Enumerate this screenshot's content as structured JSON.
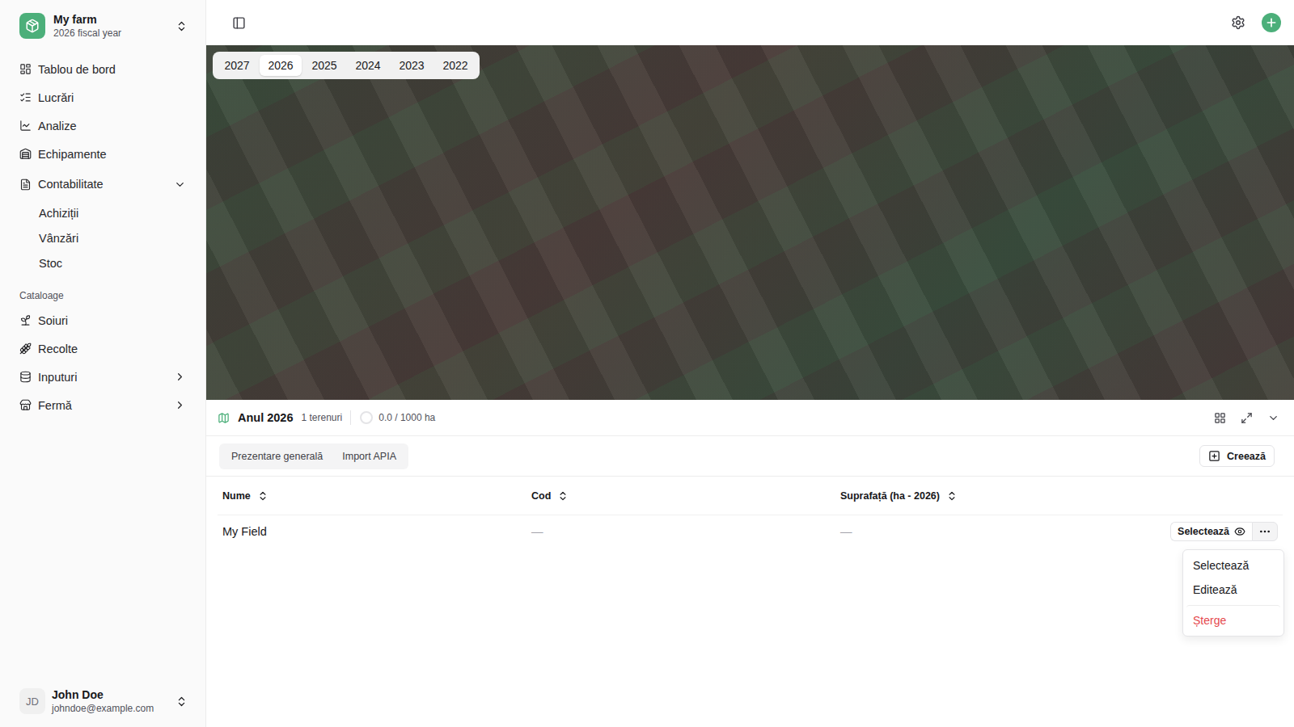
{
  "org": {
    "name": "My farm",
    "subtitle": "2026 fiscal year"
  },
  "nav": [
    {
      "label": "Tablou de bord"
    },
    {
      "label": "Lucrări"
    },
    {
      "label": "Analize"
    },
    {
      "label": "Echipamente"
    },
    {
      "label": "Contabilitate",
      "expanded": true,
      "children": [
        "Achiziții",
        "Vânzări",
        "Stoc"
      ]
    }
  ],
  "catalog": {
    "heading": "Cataloage",
    "items": [
      {
        "label": "Soiuri"
      },
      {
        "label": "Recolte"
      },
      {
        "label": "Inputuri",
        "expanded": false
      },
      {
        "label": "Fermă",
        "expanded": false
      }
    ]
  },
  "user": {
    "initials": "JD",
    "name": "John Doe",
    "email": "johndoe@example.com"
  },
  "years": [
    {
      "label": "2027",
      "selected": false
    },
    {
      "label": "2026",
      "selected": true
    },
    {
      "label": "2025",
      "selected": false
    },
    {
      "label": "2024",
      "selected": false
    },
    {
      "label": "2023",
      "selected": false
    },
    {
      "label": "2022",
      "selected": false
    }
  ],
  "panel": {
    "title": "Anul 2026",
    "count": "1 terenuri",
    "area": "0.0 / 1000 ha",
    "level": 0,
    "tabs": [
      {
        "label": "Prezentare generală",
        "selected": false
      },
      {
        "label": "Import APIA",
        "selected": false
      }
    ],
    "create": "Creează"
  },
  "table": {
    "columns": [
      "Nume",
      "Cod",
      "Suprafață (ha - 2026)"
    ],
    "rows": [
      {
        "cells": [
          "My Field",
          "—",
          "—"
        ],
        "action": "Selectează",
        "menu_open": true
      }
    ]
  },
  "menu": [
    {
      "label": "Selectează",
      "destructive": false
    },
    {
      "label": "Editează",
      "destructive": false
    },
    {
      "label": "Șterge",
      "destructive": true
    }
  ]
}
